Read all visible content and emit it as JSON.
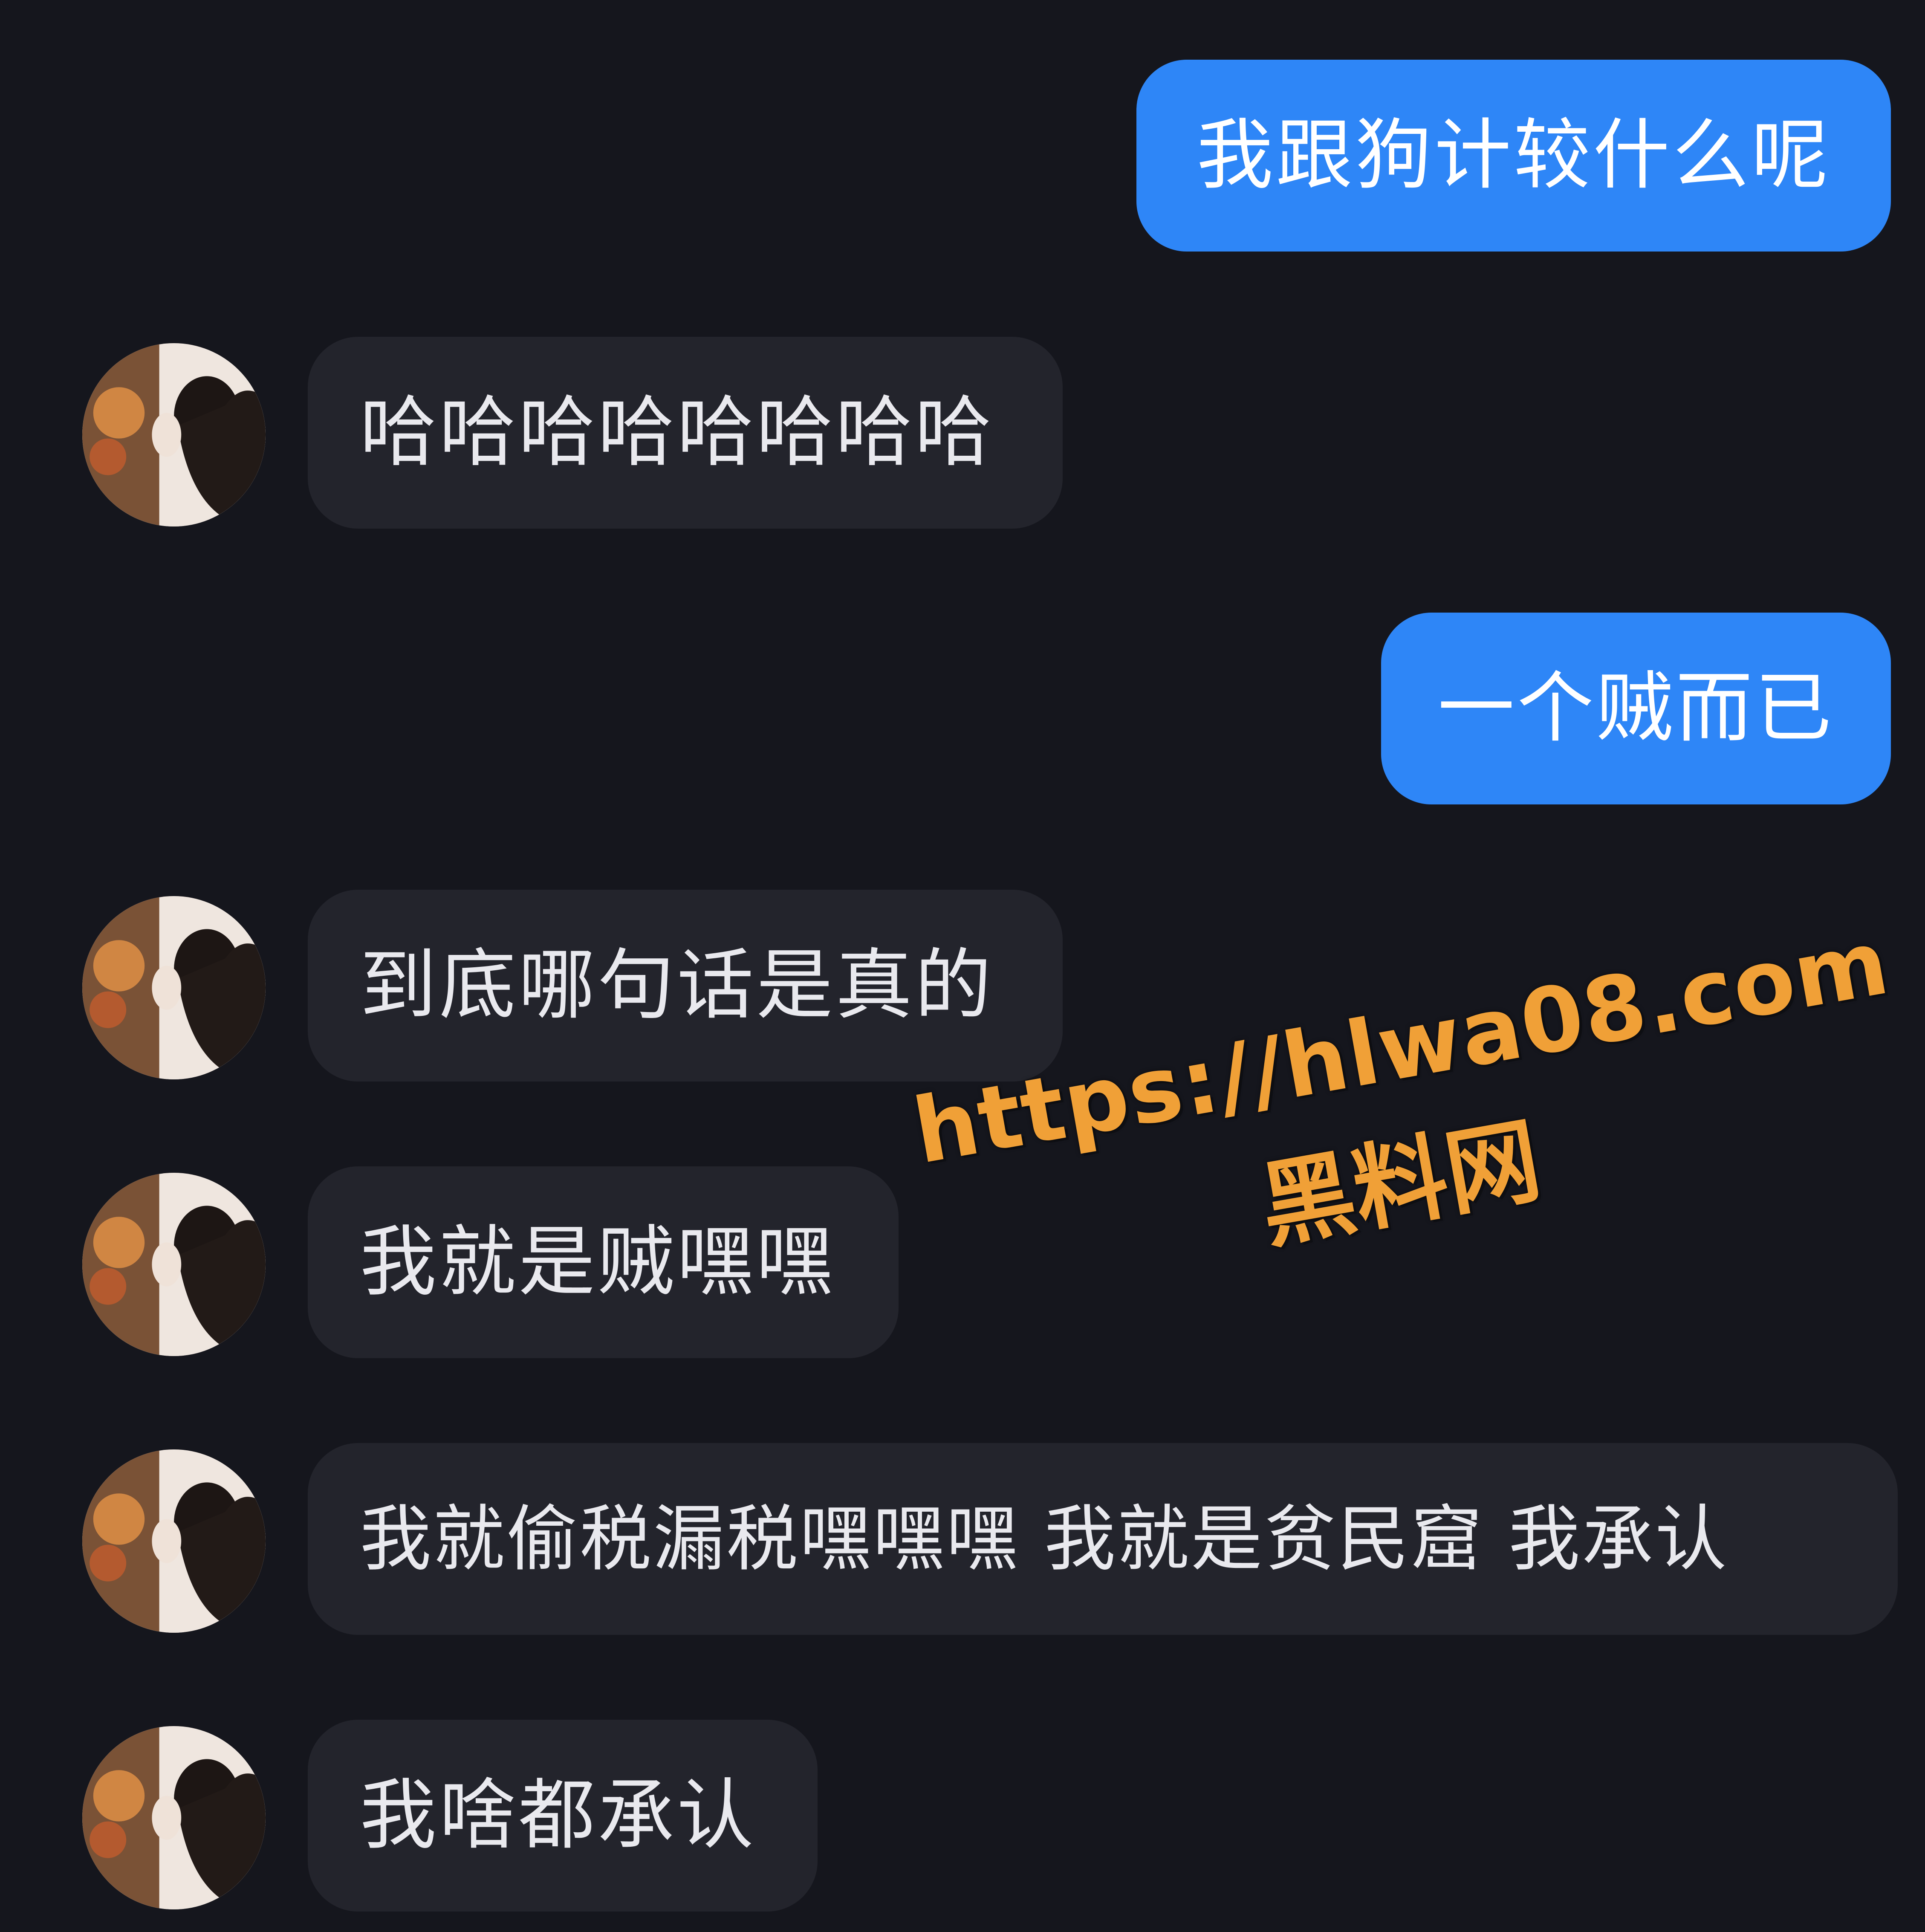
{
  "messages": [
    {
      "side": "sent",
      "text": "我跟狗计较什么呢"
    },
    {
      "side": "received",
      "text": "哈哈哈哈哈哈哈哈"
    },
    {
      "side": "sent",
      "text": "一个贼而已"
    },
    {
      "side": "received",
      "text": "到底哪句话是真的"
    },
    {
      "side": "received",
      "text": "我就是贼嘿嘿"
    },
    {
      "side": "received",
      "text": "我就偷税漏税嘿嘿嘿 我就是贫民窟 我承认"
    },
    {
      "side": "received",
      "text": "我啥都承认"
    }
  ],
  "watermark": {
    "url": "https://hlwa08.com",
    "site_name": "黑料网"
  },
  "colors": {
    "background": "#15161d",
    "sent_bubble": "#2e86f7",
    "received_bubble": "#23242c",
    "watermark": "#f0a037"
  },
  "icons": {
    "avatar": "contact-avatar-photo"
  }
}
